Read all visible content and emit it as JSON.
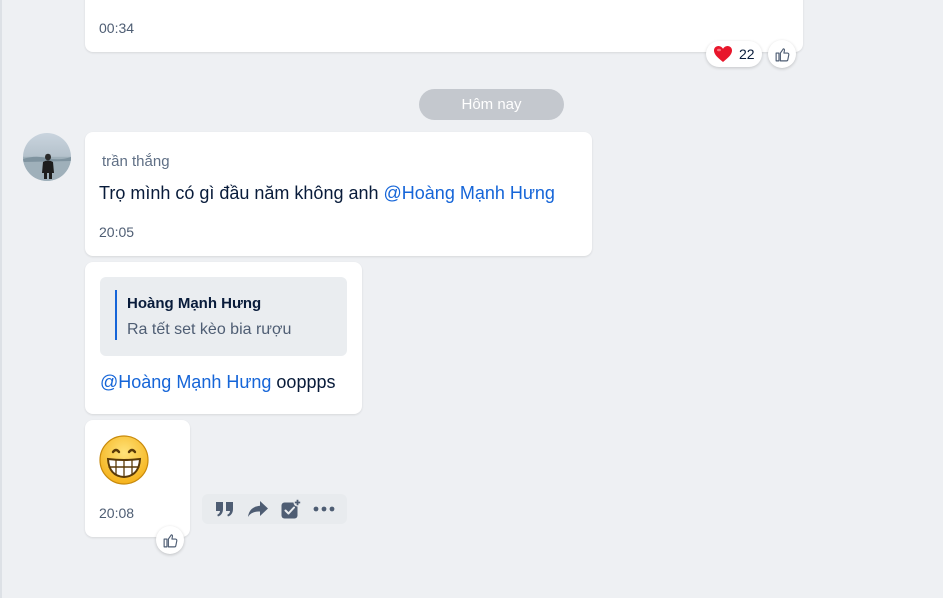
{
  "prev_message": {
    "time": "00:34",
    "reaction_count": "22",
    "reaction_icon": "heart-icon"
  },
  "date_separator": "Hôm nay",
  "message1": {
    "sender": "trần thắng",
    "text": "Trọ mình có gì đầu năm không anh ",
    "mention": "@Hoàng Mạnh Hưng",
    "time": "20:05"
  },
  "message2": {
    "quote_name": "Hoàng Mạnh Hưng",
    "quote_text": "Ra tết set kèo bia rượu",
    "mention": "@Hoàng Mạnh Hưng",
    "text": " ooppps"
  },
  "message3": {
    "emoji": "grinning-face-icon",
    "time": "20:08"
  },
  "toolbar": {
    "icons": [
      "quote-icon",
      "forward-icon",
      "add-task-icon",
      "more-icon"
    ]
  },
  "colors": {
    "mention": "#1565d8",
    "background": "#eef0f3",
    "text": "#081b3a",
    "time": "#4e5d73"
  }
}
